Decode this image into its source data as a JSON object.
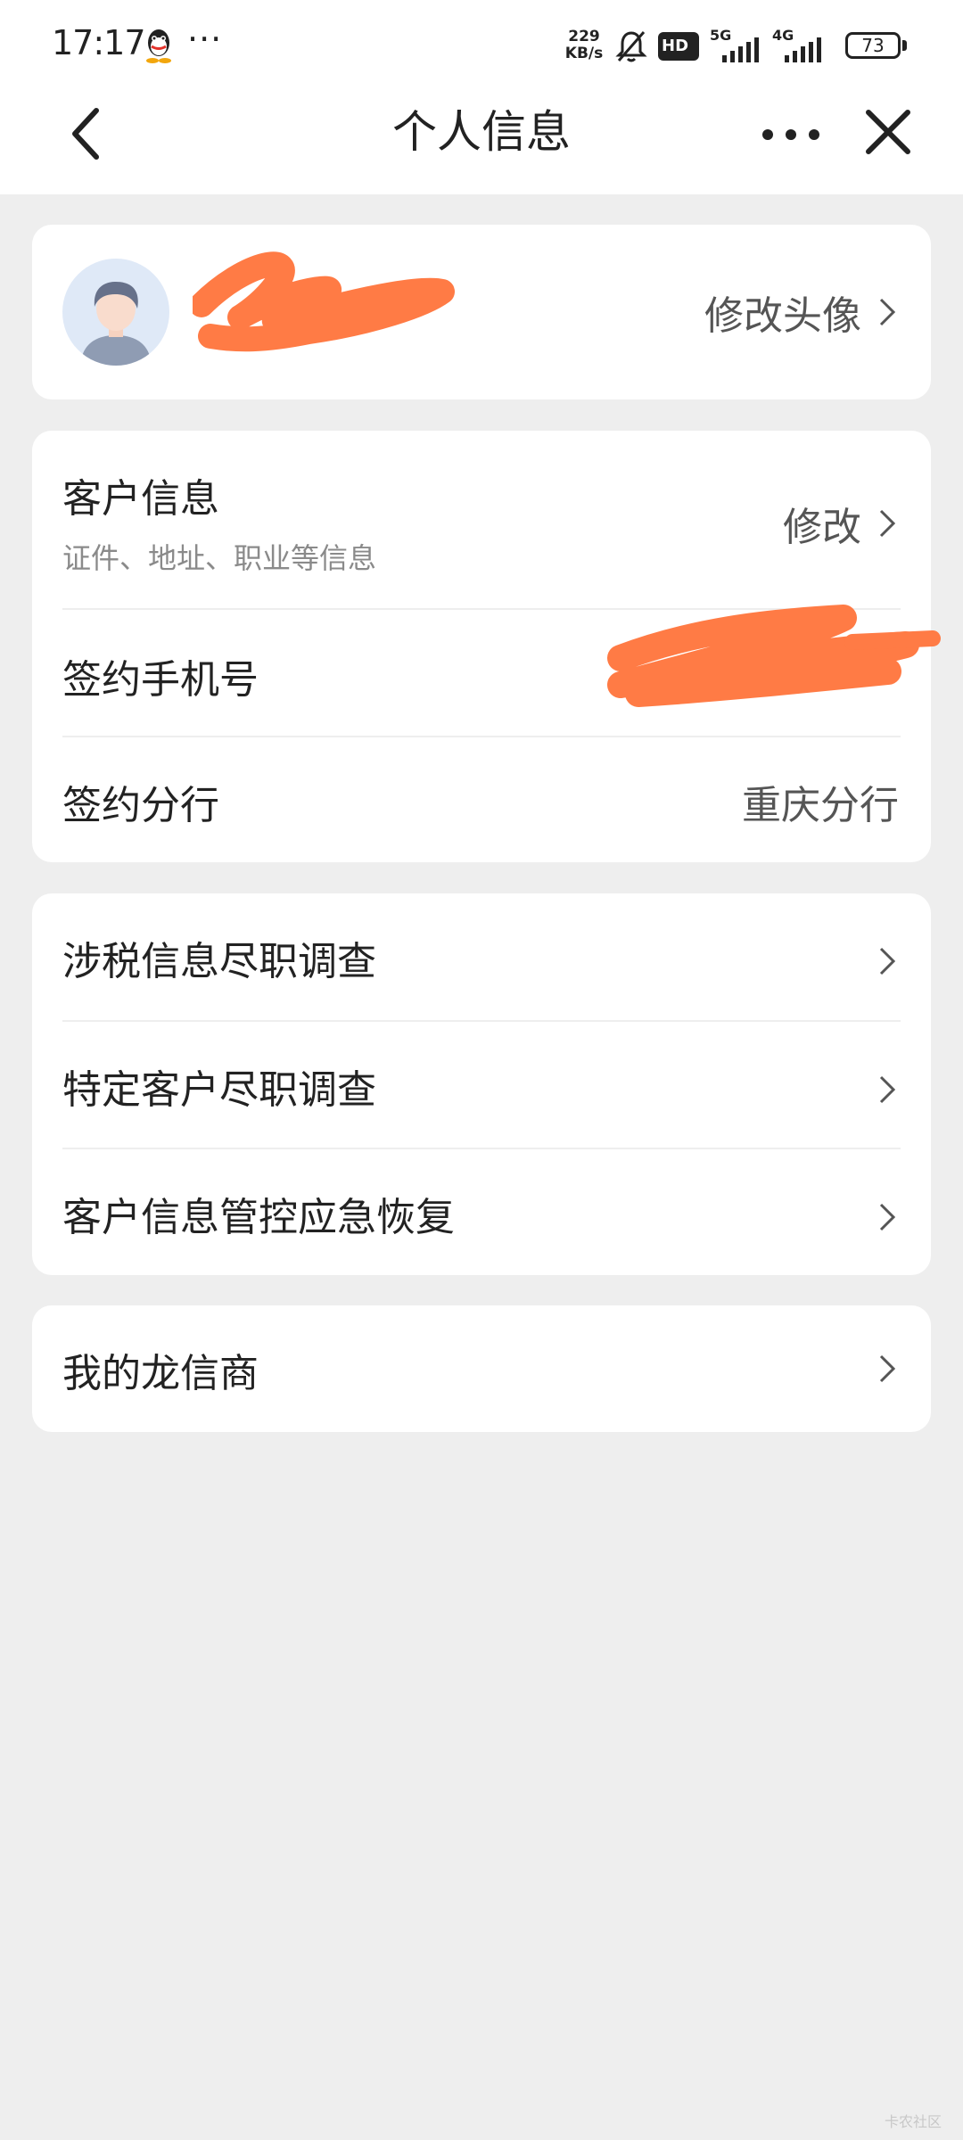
{
  "status_bar": {
    "time": "17:17",
    "more": "···",
    "net_speed_value": "229",
    "net_speed_unit": "KB/s",
    "hd_label": "HD",
    "sim1_tag": "5G",
    "sim2_tag": "4G",
    "battery": "73"
  },
  "nav": {
    "title": "个人信息"
  },
  "profile": {
    "change_avatar_label": "修改头像"
  },
  "customer_card": {
    "info_label": "客户信息",
    "info_sub": "证件、地址、职业等信息",
    "info_action": "修改",
    "phone_label": "签约手机号",
    "branch_label": "签约分行",
    "branch_value": "重庆分行"
  },
  "survey_card": {
    "items": [
      {
        "label": "涉税信息尽职调查"
      },
      {
        "label": "特定客户尽职调查"
      },
      {
        "label": "客户信息管控应急恢复"
      }
    ]
  },
  "dealer_card": {
    "label": "我的龙信商"
  },
  "watermark": "卡农社区",
  "colors": {
    "background": "#eeeeee",
    "card": "#ffffff",
    "redaction": "#ff7b45",
    "secondary_text": "#8a8a8a"
  }
}
